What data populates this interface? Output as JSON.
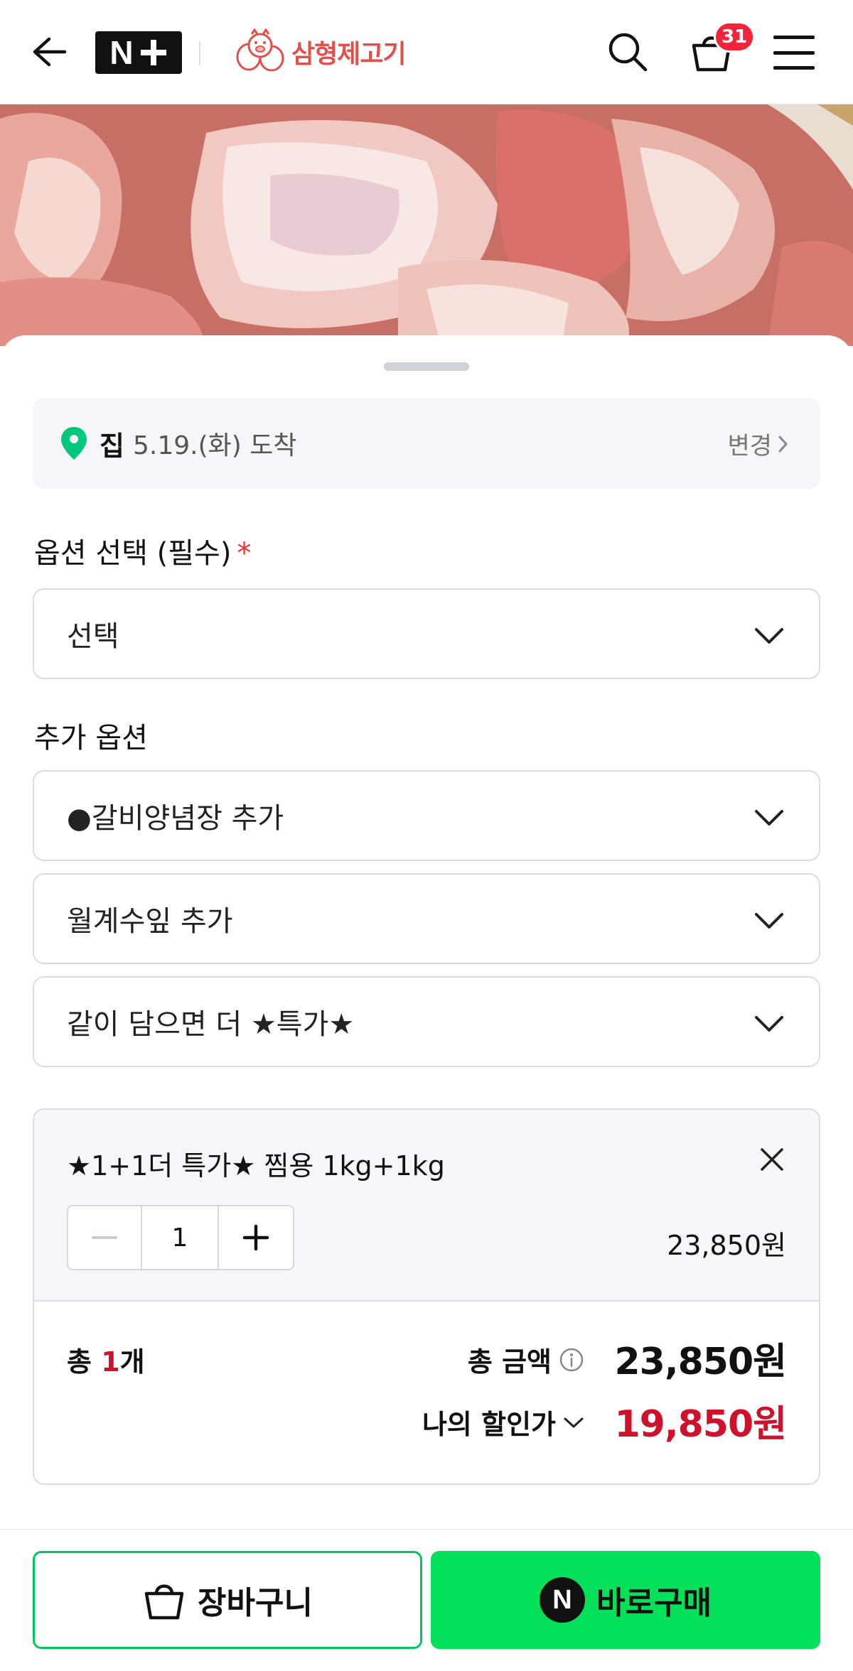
{
  "header": {
    "logo_text": "N",
    "store_name": "삼형제고기",
    "cart_count": "31"
  },
  "delivery": {
    "place": "집",
    "date_text": "5.19.(화) 도착",
    "change_label": "변경"
  },
  "options": {
    "required_title": "옵션 선택 (필수)",
    "required_star": "*",
    "required_select_value": "선택",
    "additional_title": "추가 옵션",
    "additional_selects": [
      "●갈비양념장 추가",
      "월계수잎 추가",
      "같이 담으면 더 ★특가★"
    ]
  },
  "selected_item": {
    "name": "★1+1더 특가★ 찜용 1kg+1kg",
    "quantity": "1",
    "price": "23,850원"
  },
  "summary": {
    "total_prefix": "총 ",
    "total_count": "1",
    "total_suffix": "개",
    "total_amount_label": "총 금액",
    "total_amount": "23,850원",
    "discount_label": "나의 할인가",
    "discount_price": "19,850원"
  },
  "actions": {
    "cart_label": "장바구니",
    "buy_label": "바로구매",
    "buy_icon_letter": "N"
  },
  "colors": {
    "accent_green": "#03c75a",
    "buy_green": "#03e05a",
    "price_red": "#d0112b",
    "badge_red": "#f2243a",
    "store_red": "#e2504b"
  }
}
